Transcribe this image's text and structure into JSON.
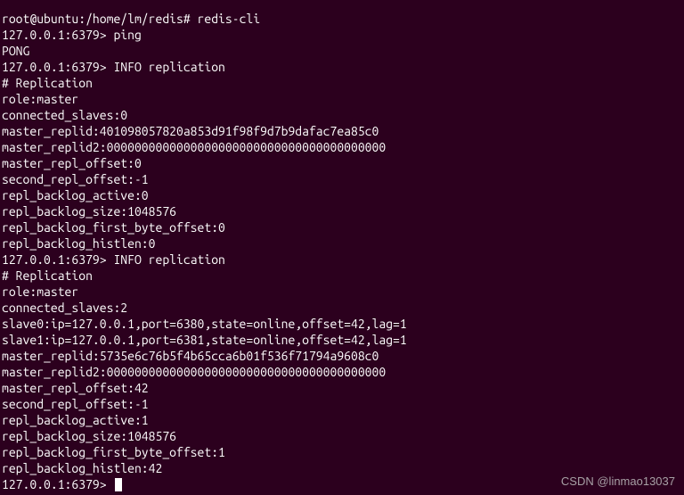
{
  "shell": {
    "prompt_root": "root@ubuntu:/home/lm/redis# ",
    "cmd_root": "redis-cli",
    "redis_prompt": "127.0.0.1:6379> ",
    "cmd_ping": "ping",
    "pong": "PONG",
    "cmd_info1": "INFO replication",
    "cmd_info2": "INFO replication"
  },
  "rep1": {
    "header": "# Replication",
    "role": "role:master",
    "connected_slaves": "connected_slaves:0",
    "master_replid": "master_replid:401098057820a853d91f98f9d7b9dafac7ea85c0",
    "master_replid2": "master_replid2:0000000000000000000000000000000000000000",
    "master_repl_offset": "master_repl_offset:0",
    "second_repl_offset": "second_repl_offset:-1",
    "repl_backlog_active": "repl_backlog_active:0",
    "repl_backlog_size": "repl_backlog_size:1048576",
    "repl_backlog_first_byte_offset": "repl_backlog_first_byte_offset:0",
    "repl_backlog_histlen": "repl_backlog_histlen:0"
  },
  "rep2": {
    "header": "# Replication",
    "role": "role:master",
    "connected_slaves": "connected_slaves:2",
    "slave0": "slave0:ip=127.0.0.1,port=6380,state=online,offset=42,lag=1",
    "slave1": "slave1:ip=127.0.0.1,port=6381,state=online,offset=42,lag=1",
    "master_replid": "master_replid:5735e6c76b5f4b65cca6b01f536f71794a9608c0",
    "master_replid2": "master_replid2:0000000000000000000000000000000000000000",
    "master_repl_offset": "master_repl_offset:42",
    "second_repl_offset": "second_repl_offset:-1",
    "repl_backlog_active": "repl_backlog_active:1",
    "repl_backlog_size": "repl_backlog_size:1048576",
    "repl_backlog_first_byte_offset": "repl_backlog_first_byte_offset:1",
    "repl_backlog_histlen": "repl_backlog_histlen:42"
  },
  "watermark": "CSDN @linmao13037"
}
